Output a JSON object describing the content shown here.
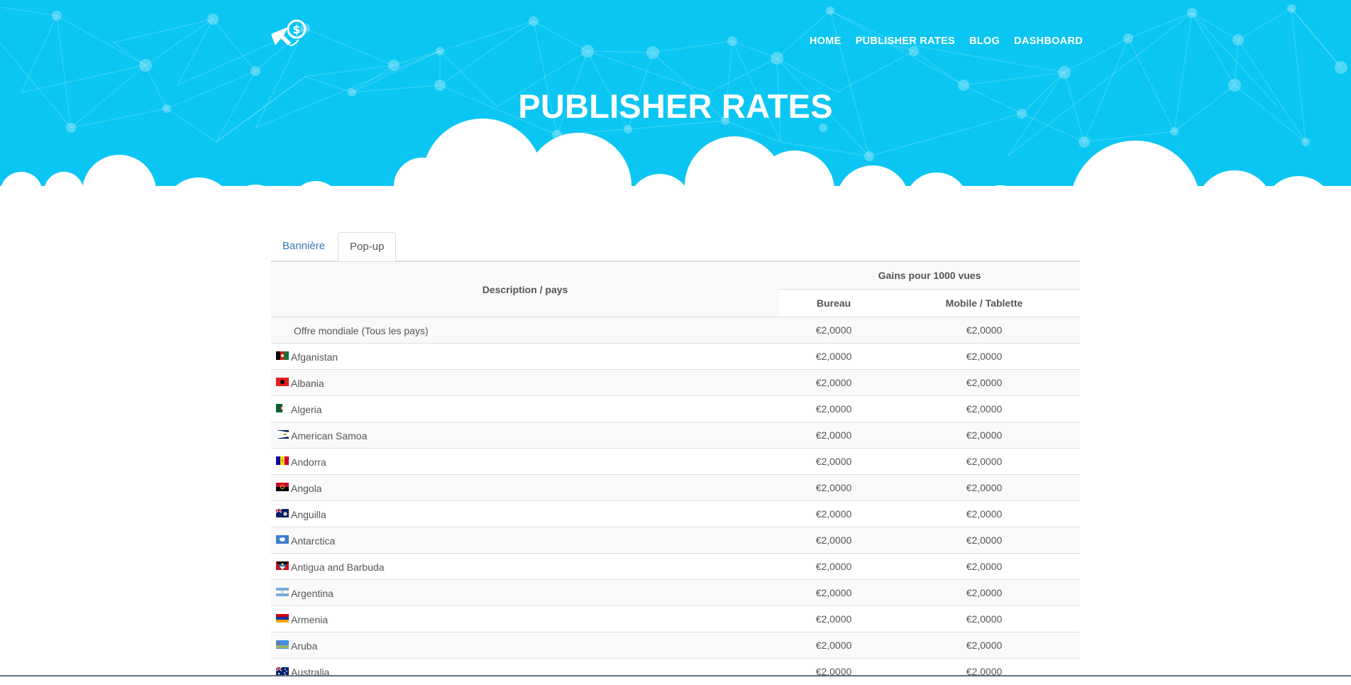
{
  "header": {
    "logo_icon": "cursor-dollar-logo-icon",
    "nav": [
      {
        "label": "HOME"
      },
      {
        "label": "PUBLISHER RATES"
      },
      {
        "label": "BLOG"
      },
      {
        "label": "DASHBOARD"
      }
    ],
    "title": "PUBLISHER RATES"
  },
  "colors": {
    "hero_bg": "#0bc6f2",
    "link": "#337ab7",
    "text": "#555555"
  },
  "tabs": [
    {
      "label": "Bannière",
      "active": false
    },
    {
      "label": "Pop-up",
      "active": true
    }
  ],
  "table": {
    "col_description": "Description / pays",
    "col_group": "Gains pour 1000 vues",
    "col_desktop": "Bureau",
    "col_mobile": "Mobile / Tablette",
    "rows": [
      {
        "name": "Offre mondiale (Tous les pays)",
        "flag": "",
        "desktop": "€2,0000",
        "mobile": "€2,0000"
      },
      {
        "name": "Afganistan",
        "flag": "af-flag-icon",
        "desktop": "€2,0000",
        "mobile": "€2,0000"
      },
      {
        "name": "Albania",
        "flag": "al-flag-icon",
        "desktop": "€2,0000",
        "mobile": "€2,0000"
      },
      {
        "name": "Algeria",
        "flag": "dz-flag-icon",
        "desktop": "€2,0000",
        "mobile": "€2,0000"
      },
      {
        "name": "American Samoa",
        "flag": "as-flag-icon",
        "desktop": "€2,0000",
        "mobile": "€2,0000"
      },
      {
        "name": "Andorra",
        "flag": "ad-flag-icon",
        "desktop": "€2,0000",
        "mobile": "€2,0000"
      },
      {
        "name": "Angola",
        "flag": "ao-flag-icon",
        "desktop": "€2,0000",
        "mobile": "€2,0000"
      },
      {
        "name": "Anguilla",
        "flag": "ai-flag-icon",
        "desktop": "€2,0000",
        "mobile": "€2,0000"
      },
      {
        "name": "Antarctica",
        "flag": "aq-flag-icon",
        "desktop": "€2,0000",
        "mobile": "€2,0000"
      },
      {
        "name": "Antigua and Barbuda",
        "flag": "ag-flag-icon",
        "desktop": "€2,0000",
        "mobile": "€2,0000"
      },
      {
        "name": "Argentina",
        "flag": "ar-flag-icon",
        "desktop": "€2,0000",
        "mobile": "€2,0000"
      },
      {
        "name": "Armenia",
        "flag": "am-flag-icon",
        "desktop": "€2,0000",
        "mobile": "€2,0000"
      },
      {
        "name": "Aruba",
        "flag": "aw-flag-icon",
        "desktop": "€2,0000",
        "mobile": "€2,0000"
      },
      {
        "name": "Australia",
        "flag": "au-flag-icon",
        "desktop": "€2,0000",
        "mobile": "€2,0000"
      }
    ]
  }
}
